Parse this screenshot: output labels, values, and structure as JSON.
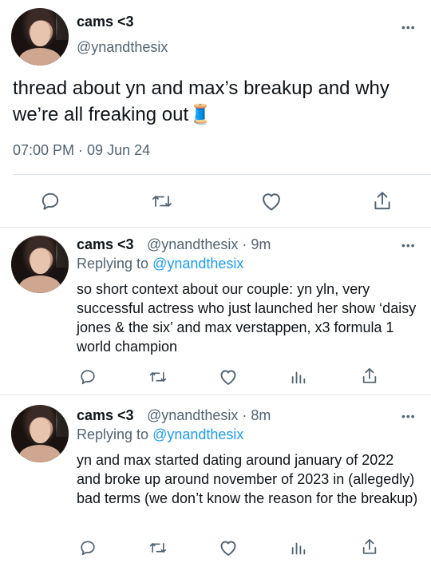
{
  "thread_header": {
    "display_name": "cams <3",
    "handle": "@ynandthesix",
    "more_label": "•••"
  },
  "main_tweet": {
    "text": "thread about yn and max’s breakup and why we’re all freaking out🧵",
    "timestamp": "07:00 PM · 09 Jun 24"
  },
  "replies": [
    {
      "display_name": "cams <3",
      "handle": "@ynandthesix",
      "time": "· 9m",
      "replying_prefix": "Replying to ",
      "replying_to": "@ynandthesix",
      "text": "so short context about our couple: yn yln, very successful actress who just launched her show ‘daisy jones & the six’ and max verstappen, x3 formula 1 world champion",
      "more_label": "•••"
    },
    {
      "display_name": "cams <3",
      "handle": "@ynandthesix",
      "time": "· 8m",
      "replying_prefix": "Replying to ",
      "replying_to": "@ynandthesix",
      "text": "yn and max started dating around january of 2022 and broke up around november of 2023 in (allegedly) bad terms (we don’t know the reason for the breakup)",
      "more_label": "•••"
    }
  ],
  "icons": {
    "reply": "reply-icon",
    "retweet": "retweet-icon",
    "like": "heart-icon",
    "views": "analytics-icon",
    "share": "share-icon"
  },
  "colors": {
    "text": "#0f1419",
    "secondary": "#536471",
    "link": "#1d9bf0",
    "divider": "#e1e6ea"
  }
}
